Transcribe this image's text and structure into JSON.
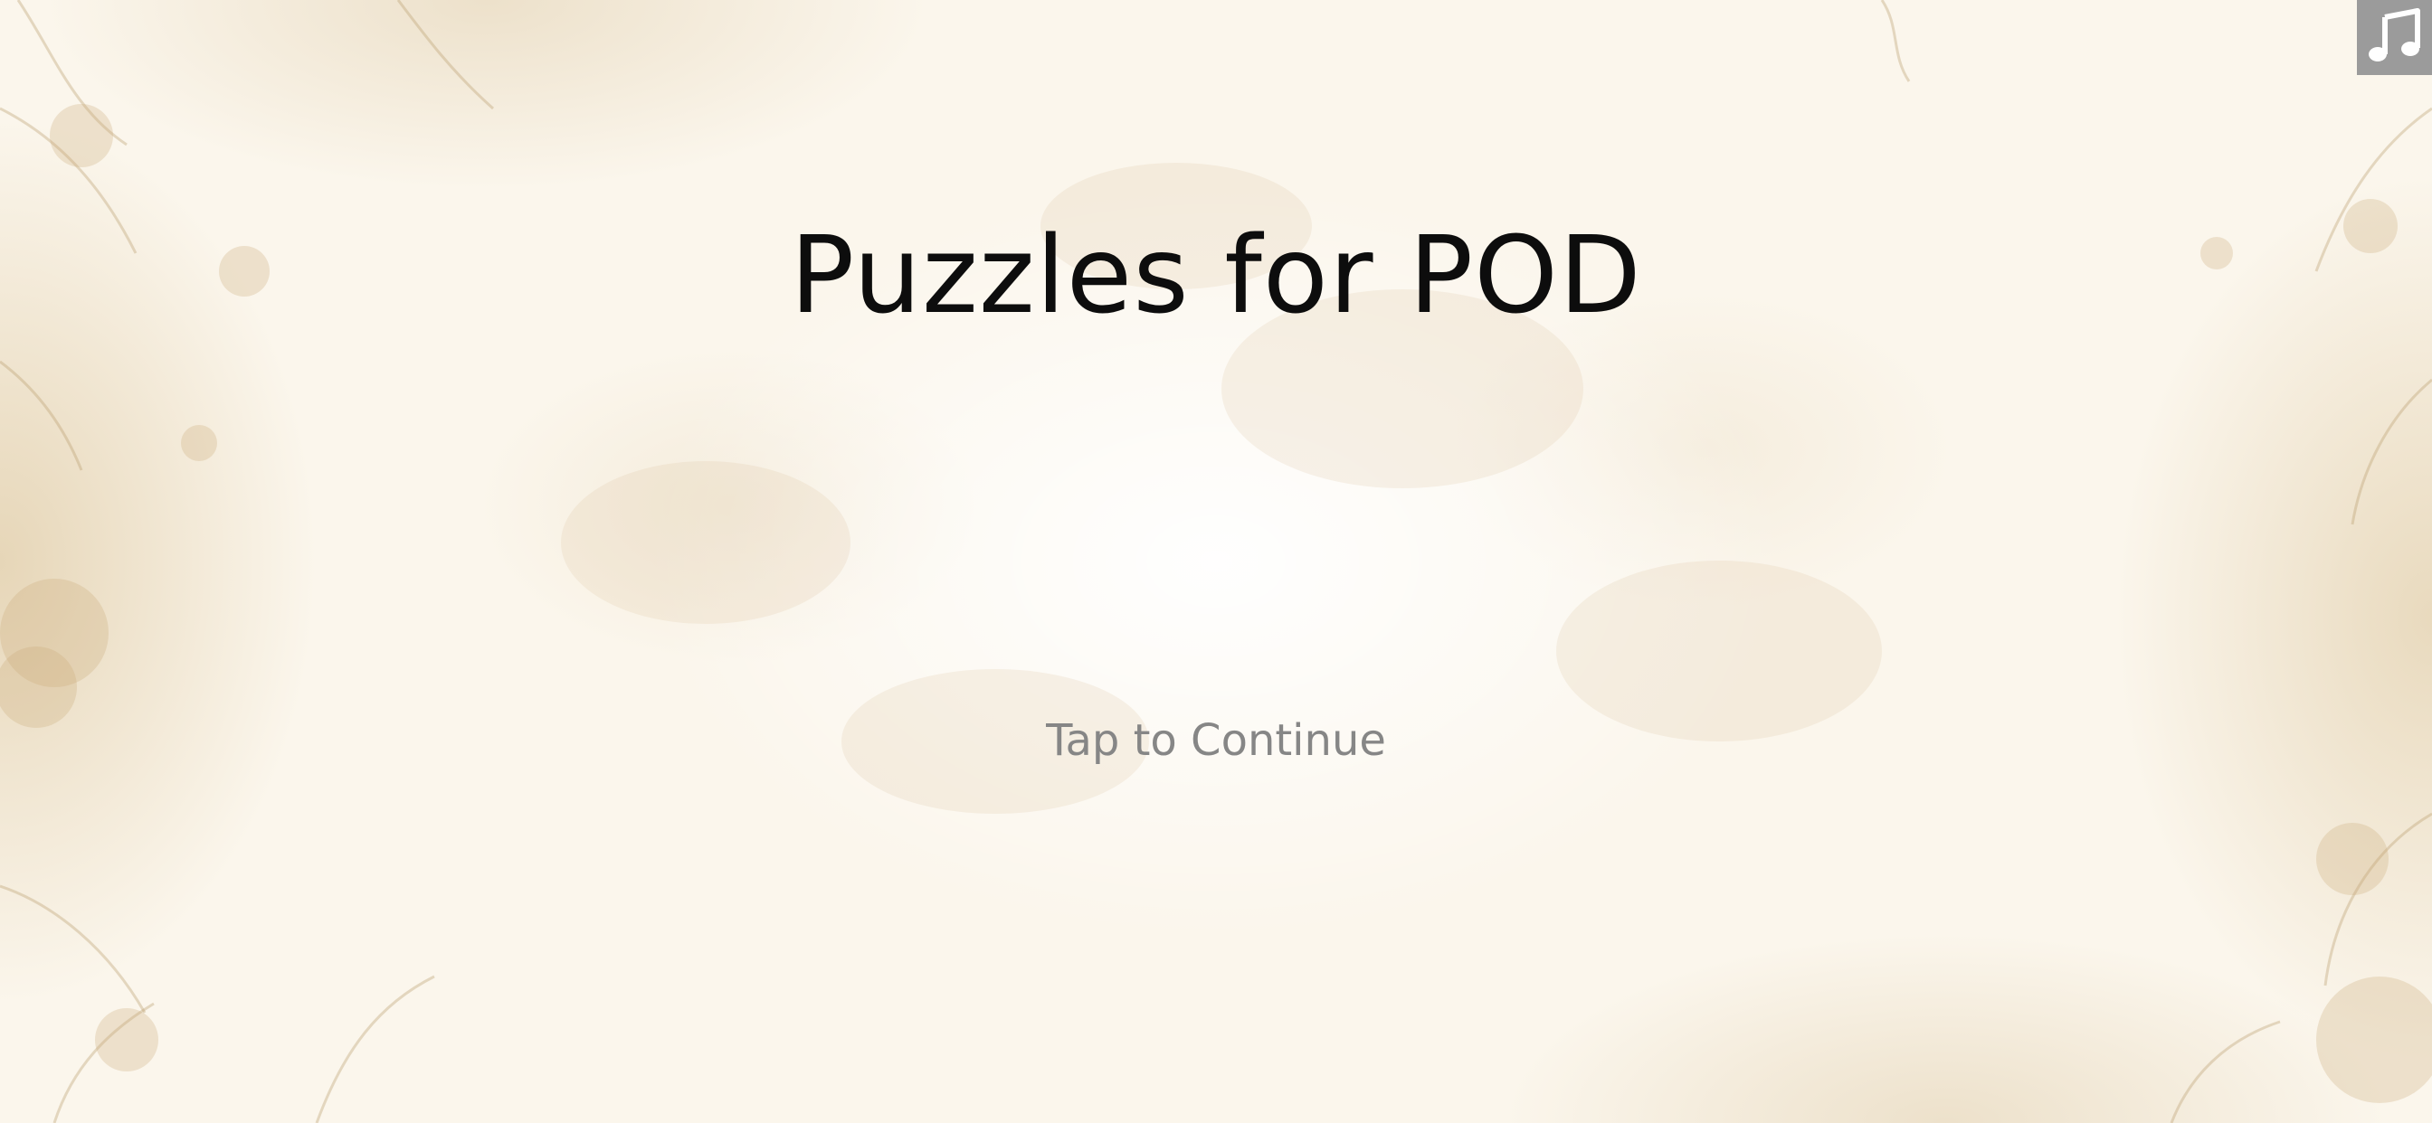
{
  "game": {
    "title": "Puzzles for POD",
    "prompt": "Tap to Continue"
  },
  "controls": {
    "music_icon": "music-note-icon"
  },
  "colors": {
    "background": "#fbf6ec",
    "title_text": "#0d0d0d",
    "prompt_text": "#868686",
    "music_button_bg": "#9b9b9b",
    "music_icon_fg": "#ffffff"
  }
}
